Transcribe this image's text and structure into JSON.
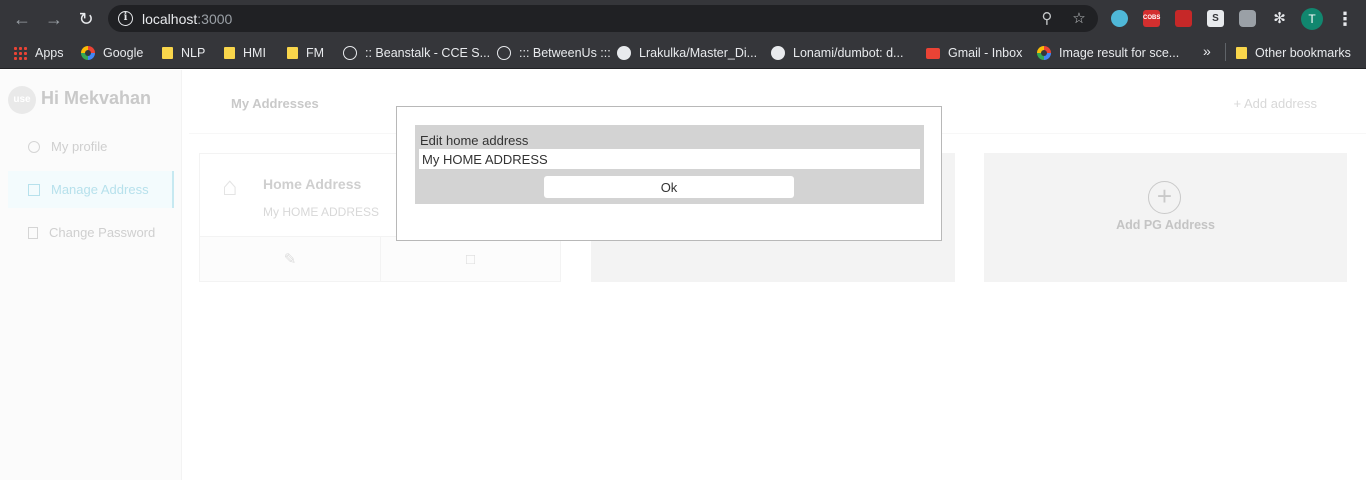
{
  "browser": {
    "url_host": "localhost",
    "url_port": ":3000",
    "profile_initial": "T",
    "ext_cobs": "COBS",
    "ext_s": "S",
    "bookmarks": [
      "Apps",
      "Google",
      "NLP",
      "HMI",
      "FM",
      ":: Beanstalk - CCE S...",
      "::: BetweenUs :::",
      "Lrakulka/Master_Di...",
      "Lonami/dumbot: d...",
      "Gmail - Inbox",
      "Image result for sce..."
    ],
    "more_bookmarks": "»",
    "other_bookmarks": "Other bookmarks"
  },
  "sidebar": {
    "logo": "use",
    "greeting": "Hi Mekvahan",
    "items": [
      "My profile",
      "Manage Address",
      "Change Password"
    ]
  },
  "main": {
    "title": "My Addresses",
    "add_link": "+ Add address",
    "home_card": {
      "title": "Home Address",
      "address": "My HOME ADDRESS"
    },
    "pg_card": {
      "label": "Add PG Address"
    }
  },
  "modal": {
    "label": "Edit home address",
    "input_value": "My HOME ADDRESS",
    "ok_label": "Ok"
  }
}
